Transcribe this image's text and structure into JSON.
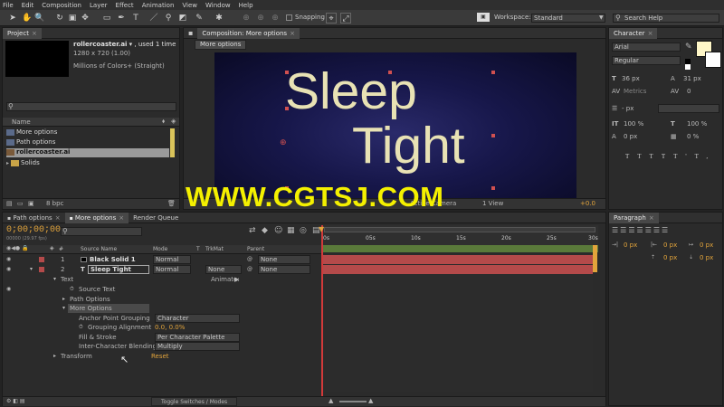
{
  "menu": [
    "File",
    "Edit",
    "Composition",
    "Layer",
    "Effect",
    "Animation",
    "View",
    "Window",
    "Help"
  ],
  "toolbar": {
    "snapping_label": "Snapping",
    "workspace_label": "Workspace:",
    "workspace_value": "Standard",
    "search_placeholder": "Search Help"
  },
  "project": {
    "tab": "Project",
    "item_name": "rollercoaster.ai",
    "item_used": ", used 1 time",
    "item_dims": "1280 x 720 (1.00)",
    "item_colors": "Millions of Colors+ (Straight)",
    "col_name": "Name",
    "items": [
      "More options",
      "Path options",
      "rollercoaster.ai",
      "Solids"
    ],
    "bpc": "8 bpc"
  },
  "composition": {
    "tab": "Composition: More options",
    "subtab": "More options",
    "line1": "Sleep",
    "line2": "Tight",
    "footer_camera": "Active Camera",
    "footer_view": "1 View",
    "footer_exposure": "+0.0"
  },
  "character": {
    "tab": "Character",
    "font": "Arial",
    "style": "Regular",
    "size": "36 px",
    "leading": "31 px",
    "kerning": "Metrics",
    "tracking": "0",
    "stroke": "- px",
    "vscale": "100 %",
    "hscale": "100 %",
    "baseline": "0 px",
    "tsume": "0 %"
  },
  "paragraph": {
    "tab": "Paragraph",
    "indent1": "0 px",
    "indent2": "0 px",
    "indent3": "0 px",
    "space1": "0 px",
    "space2": "0 px"
  },
  "timeline": {
    "tabs": [
      "Path options",
      "More options",
      "Render Queue"
    ],
    "timecode": "0;00;00;00",
    "fps": "00000 (29.97 fps)",
    "col_source": "Source Name",
    "col_mode": "Mode",
    "col_t": "T",
    "col_trkmat": "TrkMat",
    "col_parent": "Parent",
    "layers": [
      {
        "num": "1",
        "name": "Black Solid 1",
        "mode": "Normal",
        "trkmat": "",
        "parent": "None"
      },
      {
        "num": "2",
        "name": "Sleep    Tight",
        "mode": "Normal",
        "trkmat": "None",
        "parent": "None"
      }
    ],
    "text_group": "Text",
    "animate": "Animate:",
    "source_text": "Source Text",
    "path_options": "Path Options",
    "more_options": "More Options",
    "anchor_label": "Anchor Point Grouping",
    "anchor_value": "Character",
    "grouping_label": "Grouping Alignment",
    "grouping_value": "0.0, 0.0%",
    "fill_label": "Fill & Stroke",
    "fill_value": "Per Character Palette",
    "blend_label": "Inter-Character Blending",
    "blend_value": "Multiply",
    "transform_label": "Transform",
    "transform_value": "Reset",
    "ruler": [
      "0s",
      "05s",
      "10s",
      "15s",
      "20s",
      "25s",
      "30s"
    ],
    "toggle_label": "Toggle Switches / Modes"
  },
  "watermark": "WWW.CGTSJ.COM",
  "colors": {
    "accent": "#e2a43b",
    "layer_bar": "#b44a4a",
    "watermark": "#f4f000"
  }
}
